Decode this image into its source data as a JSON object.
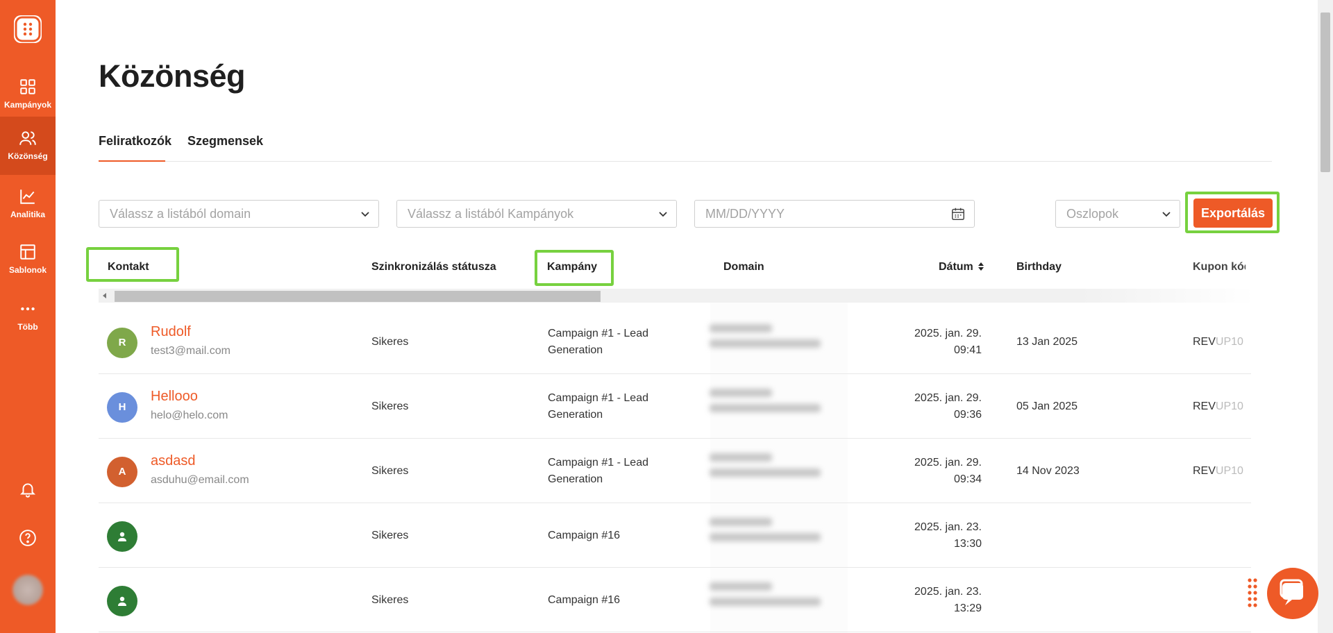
{
  "colors": {
    "brand": "#ee5a27",
    "brand_dark": "#d44a1c",
    "highlight": "#77d13f",
    "link": "#ee5a27"
  },
  "sidebar": {
    "logo_icon": "dots-grid-logo-icon",
    "items": [
      {
        "label": "Kampányok",
        "icon": "grid-icon"
      },
      {
        "label": "Közönség",
        "icon": "users-icon",
        "active": true
      },
      {
        "label": "Analitika",
        "icon": "line-chart-icon"
      },
      {
        "label": "Sablonok",
        "icon": "layout-icon"
      },
      {
        "label": "Több",
        "icon": "more-dots-icon"
      }
    ],
    "bottom_icons": [
      "bell-icon",
      "help-icon",
      "avatar"
    ]
  },
  "page": {
    "title": "Közönség"
  },
  "tabs": [
    {
      "label": "Feliratkozók",
      "active": true
    },
    {
      "label": "Szegmensek",
      "active": false
    }
  ],
  "filters": {
    "domain_placeholder": "Válassz a listából domain",
    "campaign_placeholder": "Válassz a listából Kampányok",
    "date_placeholder": "MM/DD/YYYY",
    "columns_placeholder": "Oszlopok",
    "export_label": "Exportálás"
  },
  "table": {
    "headers": {
      "contact": "Kontakt",
      "sync": "Szinkronizálás státusza",
      "campaign": "Kampány",
      "domain": "Domain",
      "date": "Dátum",
      "birthday": "Birthday",
      "coupon": "Kupon kód"
    },
    "rows": [
      {
        "initial": "R",
        "avatar_color": "#7fa84a",
        "name": "Rudolf",
        "email": "test3@mail.com",
        "sync": "Sikeres",
        "campaign_line1": "Campaign #1 - Lead",
        "campaign_line2": "Generation",
        "date_line1": "2025. jan. 29.",
        "date_line2": "09:41",
        "birthday": "13 Jan 2025",
        "coupon_a": "REV",
        "coupon_b": "UP10"
      },
      {
        "initial": "H",
        "avatar_color": "#6a8fdc",
        "name": "Hellooo",
        "email": "helo@helo.com",
        "sync": "Sikeres",
        "campaign_line1": "Campaign #1 - Lead",
        "campaign_line2": "Generation",
        "date_line1": "2025. jan. 29.",
        "date_line2": "09:36",
        "birthday": "05 Jan 2025",
        "coupon_a": "REV",
        "coupon_b": "UP10"
      },
      {
        "initial": "A",
        "avatar_color": "#d2602f",
        "name": "asdasd",
        "email": "asduhu@email.com",
        "sync": "Sikeres",
        "campaign_line1": "Campaign #1 - Lead",
        "campaign_line2": "Generation",
        "date_line1": "2025. jan. 29.",
        "date_line2": "09:34",
        "birthday": "14 Nov 2023",
        "coupon_a": "REV",
        "coupon_b": "UP10"
      },
      {
        "initial": "",
        "avatar_color": "#2e7d35",
        "name": "",
        "email": "",
        "sync": "Sikeres",
        "campaign_line1": "Campaign #16",
        "campaign_line2": "",
        "date_line1": "2025. jan. 23.",
        "date_line2": "13:30",
        "birthday": "",
        "coupon_a": "",
        "coupon_b": ""
      },
      {
        "initial": "",
        "avatar_color": "#2e7d35",
        "name": "",
        "email": "",
        "sync": "Sikeres",
        "campaign_line1": "Campaign #16",
        "campaign_line2": "",
        "date_line1": "2025. jan. 23.",
        "date_line2": "13:29",
        "birthday": "",
        "coupon_a": "",
        "coupon_b": ""
      }
    ]
  },
  "icons": {
    "chat": "chat-bubble-icon",
    "drag": "drag-handle-icon",
    "calendar": "calendar-icon",
    "sort": "sort-icon",
    "chevron": "chevron-down-icon"
  }
}
